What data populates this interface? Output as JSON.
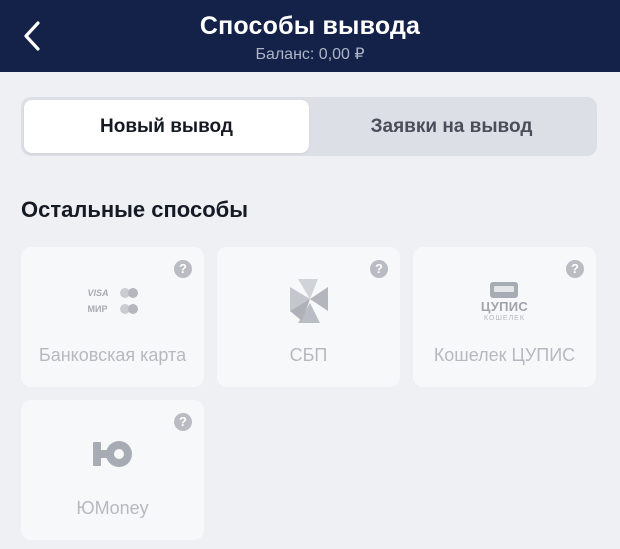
{
  "header": {
    "title": "Способы вывода",
    "balance": "Баланс: 0,00 ₽"
  },
  "tabs": [
    {
      "label": "Новый вывод",
      "active": true
    },
    {
      "label": "Заявки на вывод",
      "active": false
    }
  ],
  "section": {
    "title": "Остальные способы"
  },
  "methods": [
    {
      "label": "Банковская карта",
      "icon": "bank-card-icon",
      "card_brands": [
        "VISA",
        "МИР"
      ]
    },
    {
      "label": "СБП",
      "icon": "sbp-icon"
    },
    {
      "label": "Кошелек ЦУПИС",
      "icon": "cupis-wallet-icon",
      "icon_text": "ЦУПИС",
      "icon_subtext": "КОШЕЛЕК"
    },
    {
      "label": "ЮMoney",
      "icon": "yumoney-icon"
    }
  ],
  "help_symbol": "?",
  "colors": {
    "header_bg": "#142148",
    "page_bg": "#eef0f4",
    "card_bg": "#f7f8fa",
    "muted_text": "#b6b9c0"
  }
}
